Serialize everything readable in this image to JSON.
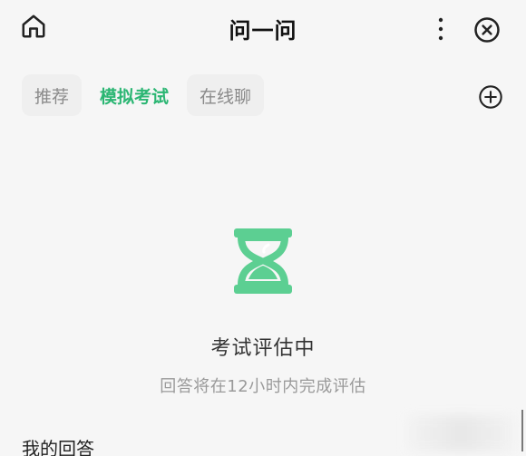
{
  "header": {
    "title": "问一问"
  },
  "icons": {
    "home": "home-icon",
    "more": "more-vertical-icon",
    "close": "close-circle-icon",
    "add": "add-circle-icon",
    "hourglass": "hourglass-icon"
  },
  "tabs": [
    {
      "label": "推荐",
      "active": false
    },
    {
      "label": "模拟考试",
      "active": true
    },
    {
      "label": "在线聊",
      "active": false
    }
  ],
  "status": {
    "title": "考试评估中",
    "subtitle": "回答将在12小时内完成评估"
  },
  "section": {
    "title": "我的回答"
  },
  "colors": {
    "accent": "#2bb673",
    "icon": "#222222",
    "muted_text": "#9a9a9a",
    "background": "#f6f6f6"
  }
}
